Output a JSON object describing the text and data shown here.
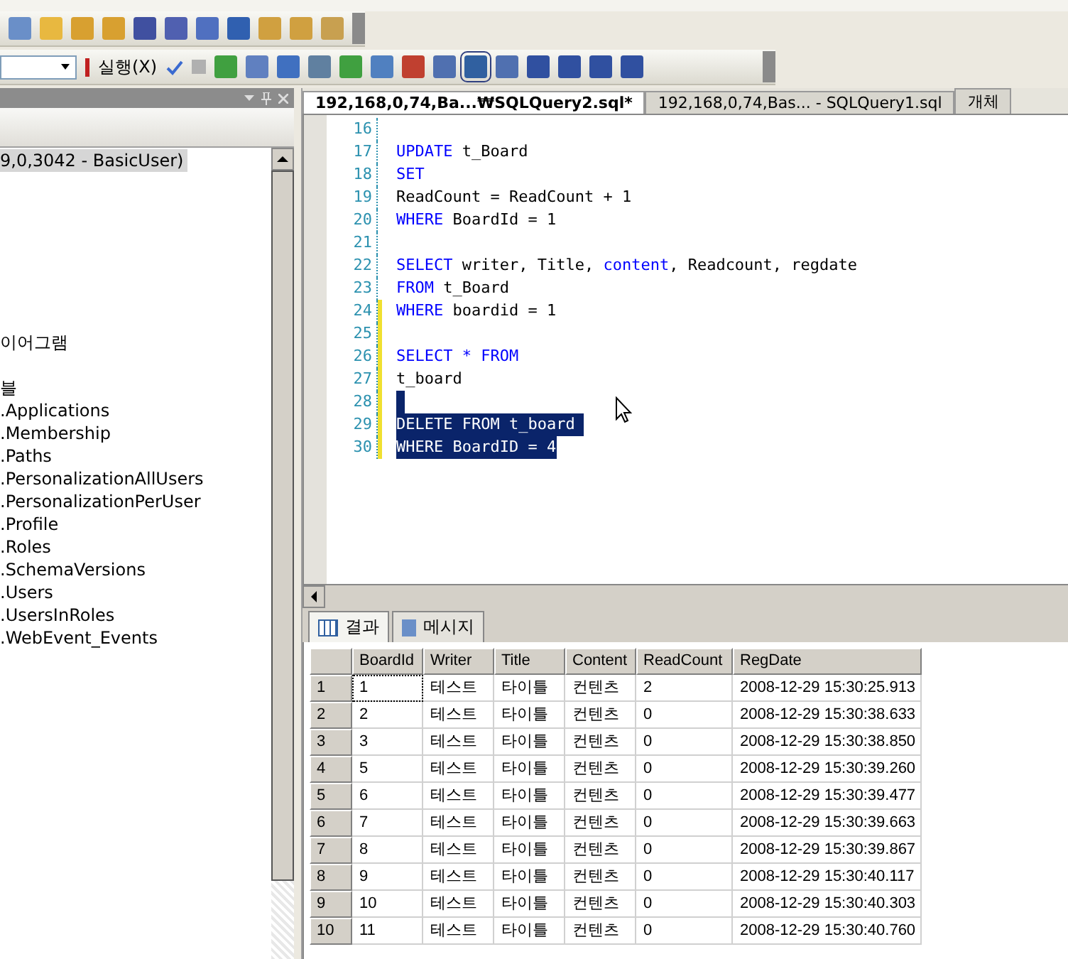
{
  "toolbar": {
    "execute_label": "실행(X)"
  },
  "object_explorer": {
    "items": [
      {
        "text": "9,0,3042 - BasicUser)",
        "selected": true
      },
      {
        "text": "이어그램",
        "selected": false
      },
      {
        "text": "블",
        "selected": false
      },
      {
        "text": ".Applications",
        "selected": false
      },
      {
        "text": ".Membership",
        "selected": false
      },
      {
        "text": ".Paths",
        "selected": false
      },
      {
        "text": ".PersonalizationAllUsers",
        "selected": false
      },
      {
        "text": ".PersonalizationPerUser",
        "selected": false
      },
      {
        "text": ".Profile",
        "selected": false
      },
      {
        "text": ".Roles",
        "selected": false
      },
      {
        "text": ".SchemaVersions",
        "selected": false
      },
      {
        "text": ".Users",
        "selected": false
      },
      {
        "text": ".UsersInRoles",
        "selected": false
      },
      {
        "text": ".WebEvent_Events",
        "selected": false
      }
    ]
  },
  "document_tabs": [
    {
      "label": "192,168,0,74,Ba...₩SQLQuery2.sql*",
      "selected": true
    },
    {
      "label": "192,168,0,74,Bas... - SQLQuery1.sql",
      "selected": false
    },
    {
      "label": "개체",
      "selected": false
    }
  ],
  "editor": {
    "lines": [
      {
        "number": "16",
        "modified": false,
        "selected": false
      },
      {
        "number": "17",
        "modified": false,
        "selected": false,
        "segments": [
          {
            "text": "UPDATE",
            "kind": "keyword"
          },
          {
            "text": " t_Board",
            "kind": "plain"
          }
        ]
      },
      {
        "number": "18",
        "modified": false,
        "selected": false,
        "segments": [
          {
            "text": "SET",
            "kind": "keyword"
          }
        ]
      },
      {
        "number": "19",
        "modified": false,
        "selected": false,
        "segments": [
          {
            "text": "ReadCount = ReadCount + 1",
            "kind": "plain"
          }
        ]
      },
      {
        "number": "20",
        "modified": false,
        "selected": false,
        "segments": [
          {
            "text": "WHERE",
            "kind": "keyword"
          },
          {
            "text": " BoardId = 1",
            "kind": "plain"
          }
        ]
      },
      {
        "number": "21",
        "modified": false,
        "selected": false
      },
      {
        "number": "22",
        "modified": false,
        "selected": false,
        "segments": [
          {
            "text": "SELECT",
            "kind": "keyword"
          },
          {
            "text": " writer, Title, ",
            "kind": "plain"
          },
          {
            "text": "content",
            "kind": "keyword"
          },
          {
            "text": ", Readcount, regdate",
            "kind": "plain"
          }
        ]
      },
      {
        "number": "23",
        "modified": false,
        "selected": false,
        "segments": [
          {
            "text": "FROM",
            "kind": "keyword"
          },
          {
            "text": " t_Board",
            "kind": "plain"
          }
        ]
      },
      {
        "number": "24",
        "modified": true,
        "selected": false,
        "segments": [
          {
            "text": "WHERE",
            "kind": "keyword"
          },
          {
            "text": " boardid = 1",
            "kind": "plain"
          }
        ]
      },
      {
        "number": "25",
        "modified": true,
        "selected": false
      },
      {
        "number": "26",
        "modified": true,
        "selected": false,
        "segments": [
          {
            "text": "SELECT * FROM",
            "kind": "keyword"
          }
        ]
      },
      {
        "number": "27",
        "modified": true,
        "selected": false,
        "segments": [
          {
            "text": "t_board",
            "kind": "plain"
          }
        ]
      },
      {
        "number": "28",
        "modified": true,
        "selected": true
      },
      {
        "number": "29",
        "modified": true,
        "selected": true,
        "segments": [
          {
            "text": "DELETE FROM",
            "kind": "keyword"
          },
          {
            "text": " t_board ",
            "kind": "plain"
          }
        ]
      },
      {
        "number": "30",
        "modified": true,
        "selected": true,
        "segments": [
          {
            "text": "WHERE",
            "kind": "keyword"
          },
          {
            "text": " BoardID = 4",
            "kind": "plain"
          }
        ]
      }
    ]
  },
  "result_tabs": [
    {
      "label": "결과",
      "selected": true,
      "kind": "grid"
    },
    {
      "label": "메시지",
      "selected": false,
      "kind": "messages"
    }
  ],
  "results": {
    "columns": [
      "BoardId",
      "Writer",
      "Title",
      "Content",
      "ReadCount",
      "RegDate"
    ],
    "rows": [
      {
        "number": "1",
        "cells": [
          "1",
          "테스트",
          "타이틀",
          "컨텐츠",
          "2",
          "2008-12-29 15:30:25.913"
        ]
      },
      {
        "number": "2",
        "cells": [
          "2",
          "테스트",
          "타이틀",
          "컨텐츠",
          "0",
          "2008-12-29 15:30:38.633"
        ]
      },
      {
        "number": "3",
        "cells": [
          "3",
          "테스트",
          "타이틀",
          "컨텐츠",
          "0",
          "2008-12-29 15:30:38.850"
        ]
      },
      {
        "number": "4",
        "cells": [
          "5",
          "테스트",
          "타이틀",
          "컨텐츠",
          "0",
          "2008-12-29 15:30:39.260"
        ]
      },
      {
        "number": "5",
        "cells": [
          "6",
          "테스트",
          "타이틀",
          "컨텐츠",
          "0",
          "2008-12-29 15:30:39.477"
        ]
      },
      {
        "number": "6",
        "cells": [
          "7",
          "테스트",
          "타이틀",
          "컨텐츠",
          "0",
          "2008-12-29 15:30:39.663"
        ]
      },
      {
        "number": "7",
        "cells": [
          "8",
          "테스트",
          "타이틀",
          "컨텐츠",
          "0",
          "2008-12-29 15:30:39.867"
        ]
      },
      {
        "number": "8",
        "cells": [
          "9",
          "테스트",
          "타이틀",
          "컨텐츠",
          "0",
          "2008-12-29 15:30:40.117"
        ]
      },
      {
        "number": "9",
        "cells": [
          "10",
          "테스트",
          "타이틀",
          "컨텐츠",
          "0",
          "2008-12-29 15:30:40.303"
        ]
      },
      {
        "number": "10",
        "cells": [
          "11",
          "테스트",
          "타이틀",
          "컨텐츠",
          "0",
          "2008-12-29 15:30:40.760"
        ]
      }
    ]
  }
}
